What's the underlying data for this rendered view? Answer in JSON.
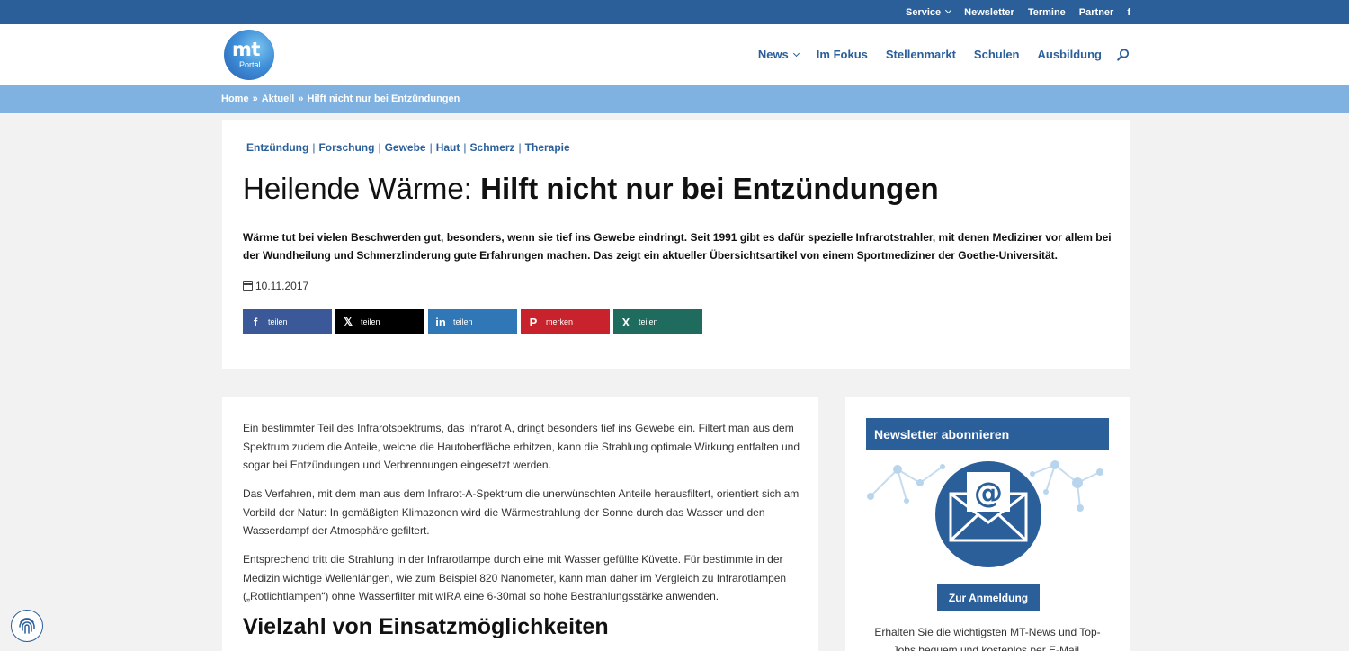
{
  "topbar": {
    "links": [
      "Service",
      "Newsletter",
      "Termine",
      "Partner"
    ],
    "facebook_glyph": "f"
  },
  "logo": {
    "line1": "mt",
    "line2": "Portal"
  },
  "nav": {
    "items": [
      "News",
      "Im Fokus",
      "Stellenmarkt",
      "Schulen",
      "Ausbildung"
    ]
  },
  "breadcrumb": {
    "items": [
      "Home",
      "Aktuell",
      "Hilft nicht nur bei Entzündungen"
    ],
    "separator": "»"
  },
  "article": {
    "tags": [
      "Entzündung",
      "Forschung",
      "Gewebe",
      "Haut",
      "Schmerz",
      "Therapie"
    ],
    "tag_separator": "|",
    "title_light": "Heilende Wärme: ",
    "title_bold": "Hilft nicht nur bei Entzündungen",
    "lead": "Wärme tut bei vielen Beschwerden gut, besonders, wenn sie tief ins Gewebe eindringt. Seit 1991 gibt es dafür spezielle Infrarotstrahler, mit denen Mediziner vor allem bei der Wundheilung und Schmerzlinderung gute Erfahrungen machen. Das zeigt ein aktueller Übersichtsartikel von einem Sportmediziner der Goethe-Universität.",
    "date": "10.11.2017",
    "share": [
      {
        "label": "teilen",
        "icon": "f"
      },
      {
        "label": "teilen",
        "icon": "𝕏"
      },
      {
        "label": "teilen",
        "icon": "in"
      },
      {
        "label": "merken",
        "icon": "P"
      },
      {
        "label": "teilen",
        "icon": "X"
      }
    ],
    "paragraphs": [
      "Ein bestimmter Teil des Infrarotspektrums, das Infrarot A, dringt besonders tief ins Gewebe ein. Filtert man aus dem Spektrum zudem die Anteile, welche die Hautoberfläche erhitzen, kann die Strahlung optimale Wirkung ent­falten und sogar bei Entzündungen und Verbrennungen eingesetzt werden.",
      "Das Verfahren, mit dem man aus dem Infrarot-A-Spektrum die unerwünschten Anteile herausfiltert, orientiert sich am Vorbild der Natur: In gemäßigten Klimazonen wird die Wärmestrahlung der Sonne durch das Wasser und den Wasserdampf der Atmosphäre gefiltert.",
      "Entsprechend tritt die Strahlung in der Infrarotlampe durch eine mit Wasser gefüllte Küvette. Für bestimmte in der Medizin wichtige Wellenlängen, wie zum Beispiel 820 Nanometer, kann man daher im Vergleich zu Infrarot­lampen („Rotlichtlampen“) ohne Wasserfilter mit wIRA eine 6-30mal so hohe Bestrahlungsstärke anwenden."
    ],
    "subheading": "Vielzahl von Einsatzmöglichkeiten"
  },
  "sidebar": {
    "newsletter_title": "Newsletter abonnieren",
    "at_glyph": "@",
    "button": "Zur Anmeldung",
    "text": "Erhalten Sie die wichtigsten MT-News und Top-Jobs bequem und kostenlos per E-Mail."
  },
  "colors": {
    "brand_blue": "#2b5f9a",
    "breadcrumb_blue": "#7fb2e0",
    "facebook": "#3b5998",
    "x": "#000000",
    "linkedin": "#2f77b6",
    "pinterest": "#c8232c",
    "xing": "#1f6b5e"
  }
}
